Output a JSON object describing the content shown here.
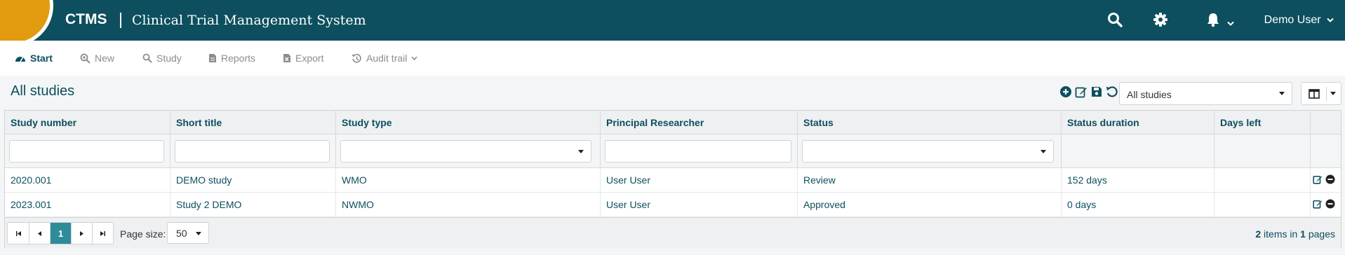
{
  "app": {
    "brand": "CTMS",
    "subtitle": "Clinical Trial Management System",
    "user": "Demo User",
    "icons": [
      "search-icon",
      "gear-icon",
      "bell-icon",
      "chevron-down-icon"
    ]
  },
  "toolbar": {
    "items": [
      {
        "label": "Start",
        "icon": "dashboard-icon",
        "active": true
      },
      {
        "label": "New",
        "icon": "zoom-in-icon",
        "active": false
      },
      {
        "label": "Study",
        "icon": "search-icon",
        "active": false
      },
      {
        "label": "Reports",
        "icon": "document-icon",
        "active": false
      },
      {
        "label": "Export",
        "icon": "excel-icon",
        "active": false
      },
      {
        "label": "Audit trail",
        "icon": "history-icon",
        "active": false
      }
    ]
  },
  "main": {
    "title": "All studies",
    "view_select": "All studies",
    "actions": [
      "add-icon",
      "edit-icon",
      "save-icon",
      "undo-icon"
    ]
  },
  "grid": {
    "columns": [
      "Study number",
      "Short title",
      "Study type",
      "Principal Researcher",
      "Status",
      "Status duration",
      "Days left"
    ],
    "rows": [
      [
        "2020.001",
        "DEMO study",
        "WMO",
        "User User",
        "Review",
        "152 days",
        ""
      ],
      [
        "2023.001",
        "Study 2 DEMO",
        "NWMO",
        "User User",
        "Approved",
        "0 days",
        ""
      ]
    ]
  },
  "pager": {
    "current_page": "1",
    "page_size_label": "Page size:",
    "page_size": "50",
    "items_count": "2",
    "items_text": "items in",
    "pages_count": "1",
    "pages_text": "pages"
  },
  "colors": {
    "primary": "#0d4f5e",
    "accent": "#e29b0f",
    "active_page": "#2e8b99"
  }
}
